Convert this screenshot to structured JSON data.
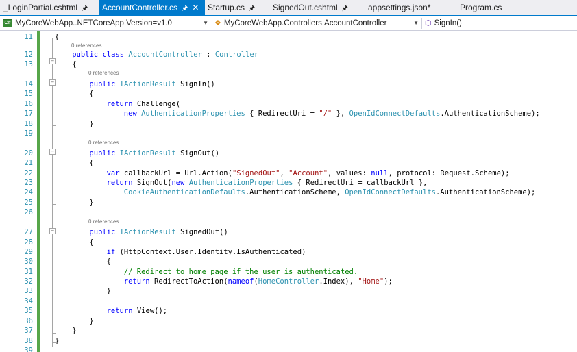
{
  "tabs": [
    {
      "label": "_LoginPartial.cshtml",
      "pinned": true,
      "active": false
    },
    {
      "label": "AccountController.cs",
      "pinned": true,
      "active": true,
      "closable": true
    },
    {
      "label": "Startup.cs",
      "pinned": true,
      "active": false
    },
    {
      "label": "SignedOut.cshtml",
      "pinned": true,
      "active": false
    },
    {
      "label": "appsettings.json*",
      "pinned": false,
      "active": false
    },
    {
      "label": "Program.cs",
      "pinned": false,
      "active": false
    }
  ],
  "nav": {
    "project": "MyCoreWebApp..NETCoreApp,Version=v1.0",
    "class": "MyCoreWebApp.Controllers.AccountController",
    "member": "SignIn()"
  },
  "icons": {
    "pin": "pin-icon",
    "close": "close-icon",
    "project": "csharp-project-icon",
    "class": "class-icon",
    "member": "method-icon"
  },
  "colors": {
    "accent": "#007acc",
    "keyword": "#0000ff",
    "type": "#2b91af",
    "string": "#a31515",
    "comment": "#008000",
    "line_number": "#2b91af"
  },
  "editor": {
    "lens_label": "0 references",
    "lines": [
      {
        "n": "11",
        "segs": [
          [
            "",
            "{"
          ]
        ]
      },
      {
        "n": "12",
        "segs": [
          [
            "k",
            "public"
          ],
          [
            "",
            " "
          ],
          [
            "k",
            "class"
          ],
          [
            "",
            " "
          ],
          [
            "t",
            "AccountController"
          ],
          [
            "",
            " : "
          ],
          [
            "t",
            "Controller"
          ]
        ]
      },
      {
        "n": "13",
        "segs": [
          [
            "",
            "{"
          ]
        ]
      },
      {
        "n": "14",
        "segs": [
          [
            "k",
            "public"
          ],
          [
            "",
            " "
          ],
          [
            "t",
            "IActionResult"
          ],
          [
            "",
            " SignIn()"
          ]
        ]
      },
      {
        "n": "15",
        "segs": [
          [
            "",
            "{"
          ]
        ]
      },
      {
        "n": "16",
        "segs": [
          [
            "k",
            "return"
          ],
          [
            "",
            " Challenge("
          ]
        ]
      },
      {
        "n": "17",
        "segs": [
          [
            "k",
            "new"
          ],
          [
            "",
            " "
          ],
          [
            "t",
            "AuthenticationProperties"
          ],
          [
            "",
            " { RedirectUri = "
          ],
          [
            "s",
            "\"/\""
          ],
          [
            "",
            " }, "
          ],
          [
            "t",
            "OpenIdConnectDefaults"
          ],
          [
            "",
            ".AuthenticationScheme);"
          ]
        ]
      },
      {
        "n": "18",
        "segs": [
          [
            "",
            "}"
          ]
        ]
      },
      {
        "n": "19",
        "segs": []
      },
      {
        "n": "20",
        "segs": [
          [
            "k",
            "public"
          ],
          [
            "",
            " "
          ],
          [
            "t",
            "IActionResult"
          ],
          [
            "",
            " SignOut()"
          ]
        ]
      },
      {
        "n": "21",
        "segs": [
          [
            "",
            "{"
          ]
        ]
      },
      {
        "n": "22",
        "segs": [
          [
            "k",
            "var"
          ],
          [
            "",
            " callbackUrl = Url.Action("
          ],
          [
            "s",
            "\"SignedOut\""
          ],
          [
            "",
            ", "
          ],
          [
            "s",
            "\"Account\""
          ],
          [
            "",
            ", values: "
          ],
          [
            "k",
            "null"
          ],
          [
            "",
            ", protocol: Request.Scheme);"
          ]
        ]
      },
      {
        "n": "23",
        "segs": [
          [
            "k",
            "return"
          ],
          [
            "",
            " SignOut("
          ],
          [
            "k",
            "new"
          ],
          [
            "",
            " "
          ],
          [
            "t",
            "AuthenticationProperties"
          ],
          [
            "",
            " { RedirectUri = callbackUrl },"
          ]
        ]
      },
      {
        "n": "24",
        "segs": [
          [
            "t",
            "CookieAuthenticationDefaults"
          ],
          [
            "",
            ".AuthenticationScheme, "
          ],
          [
            "t",
            "OpenIdConnectDefaults"
          ],
          [
            "",
            ".AuthenticationScheme);"
          ]
        ]
      },
      {
        "n": "25",
        "segs": [
          [
            "",
            "}"
          ]
        ]
      },
      {
        "n": "26",
        "segs": []
      },
      {
        "n": "27",
        "segs": [
          [
            "k",
            "public"
          ],
          [
            "",
            " "
          ],
          [
            "t",
            "IActionResult"
          ],
          [
            "",
            " SignedOut()"
          ]
        ]
      },
      {
        "n": "28",
        "segs": [
          [
            "",
            "{"
          ]
        ]
      },
      {
        "n": "29",
        "segs": [
          [
            "k",
            "if"
          ],
          [
            "",
            " (HttpContext.User.Identity.IsAuthenticated)"
          ]
        ]
      },
      {
        "n": "30",
        "segs": [
          [
            "",
            "{"
          ]
        ]
      },
      {
        "n": "31",
        "segs": [
          [
            "c",
            "// Redirect to home page if the user is authenticated."
          ]
        ]
      },
      {
        "n": "32",
        "segs": [
          [
            "k",
            "return"
          ],
          [
            "",
            " RedirectToAction("
          ],
          [
            "k",
            "nameof"
          ],
          [
            "",
            "("
          ],
          [
            "t",
            "HomeController"
          ],
          [
            "",
            ".Index), "
          ],
          [
            "s",
            "\"Home\""
          ],
          [
            "",
            ");"
          ]
        ]
      },
      {
        "n": "33",
        "segs": [
          [
            "",
            "}"
          ]
        ]
      },
      {
        "n": "34",
        "segs": []
      },
      {
        "n": "35",
        "segs": [
          [
            "k",
            "return"
          ],
          [
            "",
            " View();"
          ]
        ]
      },
      {
        "n": "36",
        "segs": [
          [
            "",
            "}"
          ]
        ]
      },
      {
        "n": "37",
        "segs": [
          [
            "",
            "}"
          ]
        ]
      },
      {
        "n": "38",
        "segs": [
          [
            "",
            "}"
          ]
        ]
      },
      {
        "n": "39",
        "segs": []
      }
    ]
  }
}
